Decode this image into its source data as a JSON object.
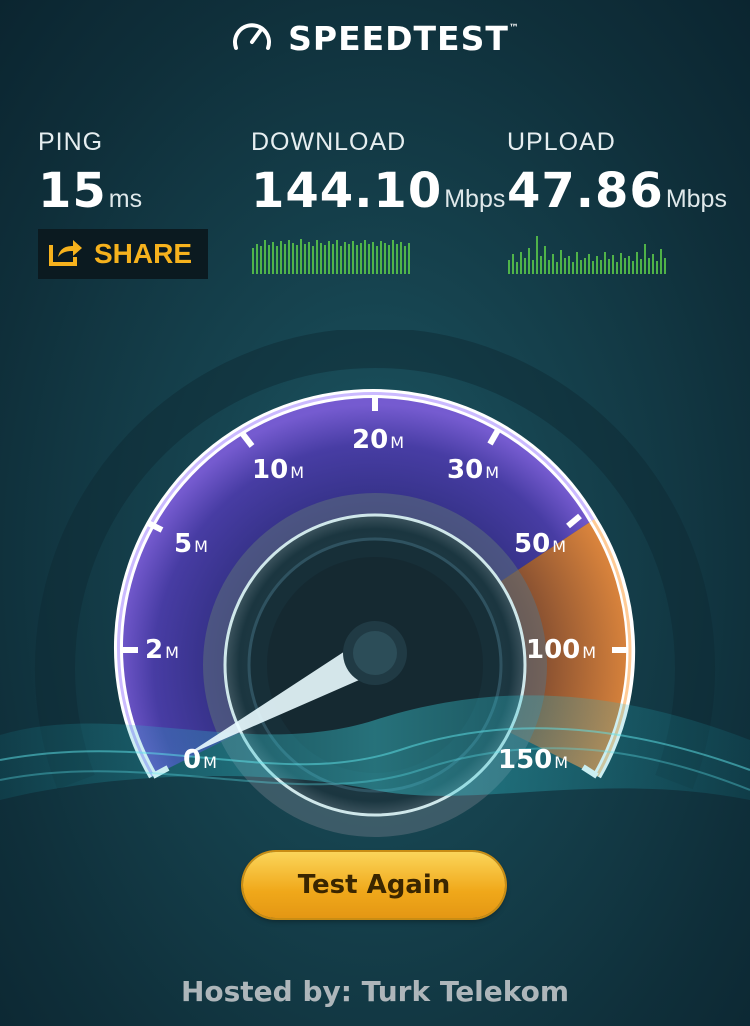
{
  "header": {
    "logo_text": "SPEEDTEST",
    "trademark": "™"
  },
  "ping": {
    "label": "PING",
    "value": "15",
    "unit": "ms"
  },
  "download": {
    "label": "DOWNLOAD",
    "value": "144.10",
    "unit": "Mbps"
  },
  "upload": {
    "label": "UPLOAD",
    "value": "47.86",
    "unit": "Mbps"
  },
  "share": {
    "label": "SHARE"
  },
  "gauge": {
    "ticks": [
      {
        "value": "0",
        "unit": "M"
      },
      {
        "value": "2",
        "unit": "M"
      },
      {
        "value": "5",
        "unit": "M"
      },
      {
        "value": "10",
        "unit": "M"
      },
      {
        "value": "20",
        "unit": "M"
      },
      {
        "value": "30",
        "unit": "M"
      },
      {
        "value": "50",
        "unit": "M"
      },
      {
        "value": "100",
        "unit": "M"
      },
      {
        "value": "150",
        "unit": "M"
      }
    ],
    "accent_purple": "#7a5cd6",
    "accent_orange": "#e88a3c"
  },
  "button": {
    "label": "Test Again"
  },
  "footer": {
    "hosted_label": "Hosted by: Turk Telekom"
  },
  "colors": {
    "share": "#f6b21d",
    "spark": "#5fd24a",
    "button": "#f0a81a"
  }
}
